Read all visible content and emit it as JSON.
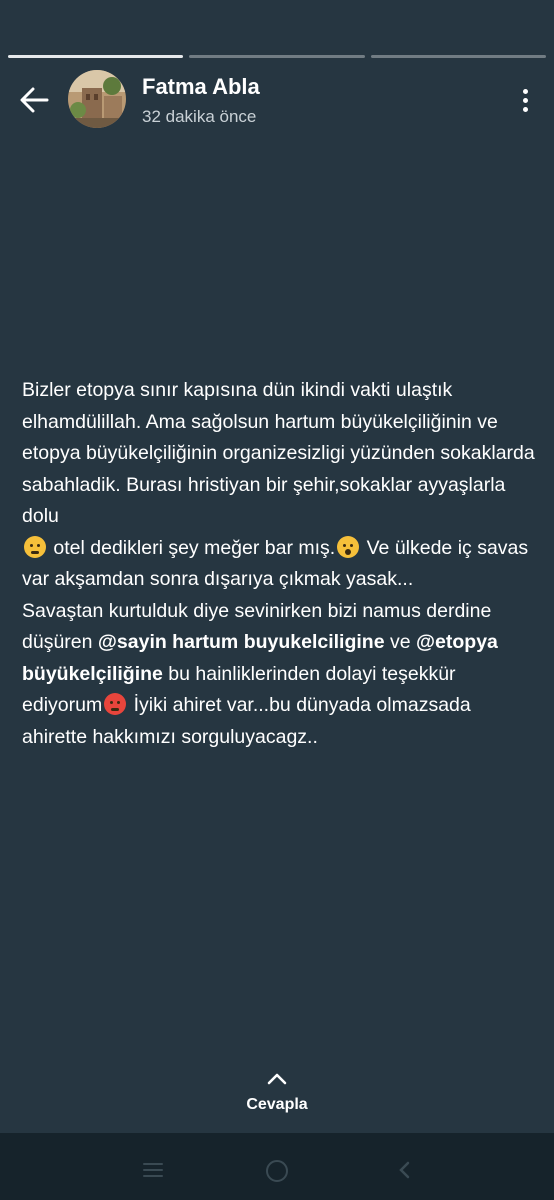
{
  "story": {
    "progress": {
      "segments": 3,
      "completed": 1
    },
    "author_name": "Fatma Abla",
    "timestamp": "32 dakika önce",
    "avatar_icon": "avatar-photo"
  },
  "text": {
    "line1": "Bizler etopya sınır kapısına dün ikindi vakti ulaştık elhamdülillah. Ama sağolsun hartum büyükelçiliğinin ve etopya büyükelçiliğinin organizesizligi yüzünden sokaklarda sabahladik. Burası hristiyan bir şehir,sokaklar ayyaşlarla dolu",
    "part2": " otel dedikleri şey meğer bar mış.",
    "part3": " Ve ülkede iç savas var akşamdan sonra dışarıya çıkmak yasak...",
    "para2_a": " Savaştan kurtulduk diye sevinirken bizi namus derdine düşüren ",
    "mention1": "@sayin hartum buyukelciligine",
    "para2_b": " ve ",
    "mention2": "@etopya büyükelçiliğine",
    "para2_c": " bu hainliklerinden dolayi teşekkür ediyorum",
    "para2_d": " İyiki ahiret var...bu dünyada olmazsada ahirette hakkımızı sorguluyacagz..",
    "emojis": [
      "pensive-face",
      "screaming-face",
      "angry-face"
    ]
  },
  "reply": {
    "label": "Cevapla",
    "icon": "chevron-up-icon"
  },
  "colors": {
    "background": "#263641",
    "navbar": "#16232b",
    "text": "#ffffff",
    "subtext": "#c9d1d6"
  }
}
